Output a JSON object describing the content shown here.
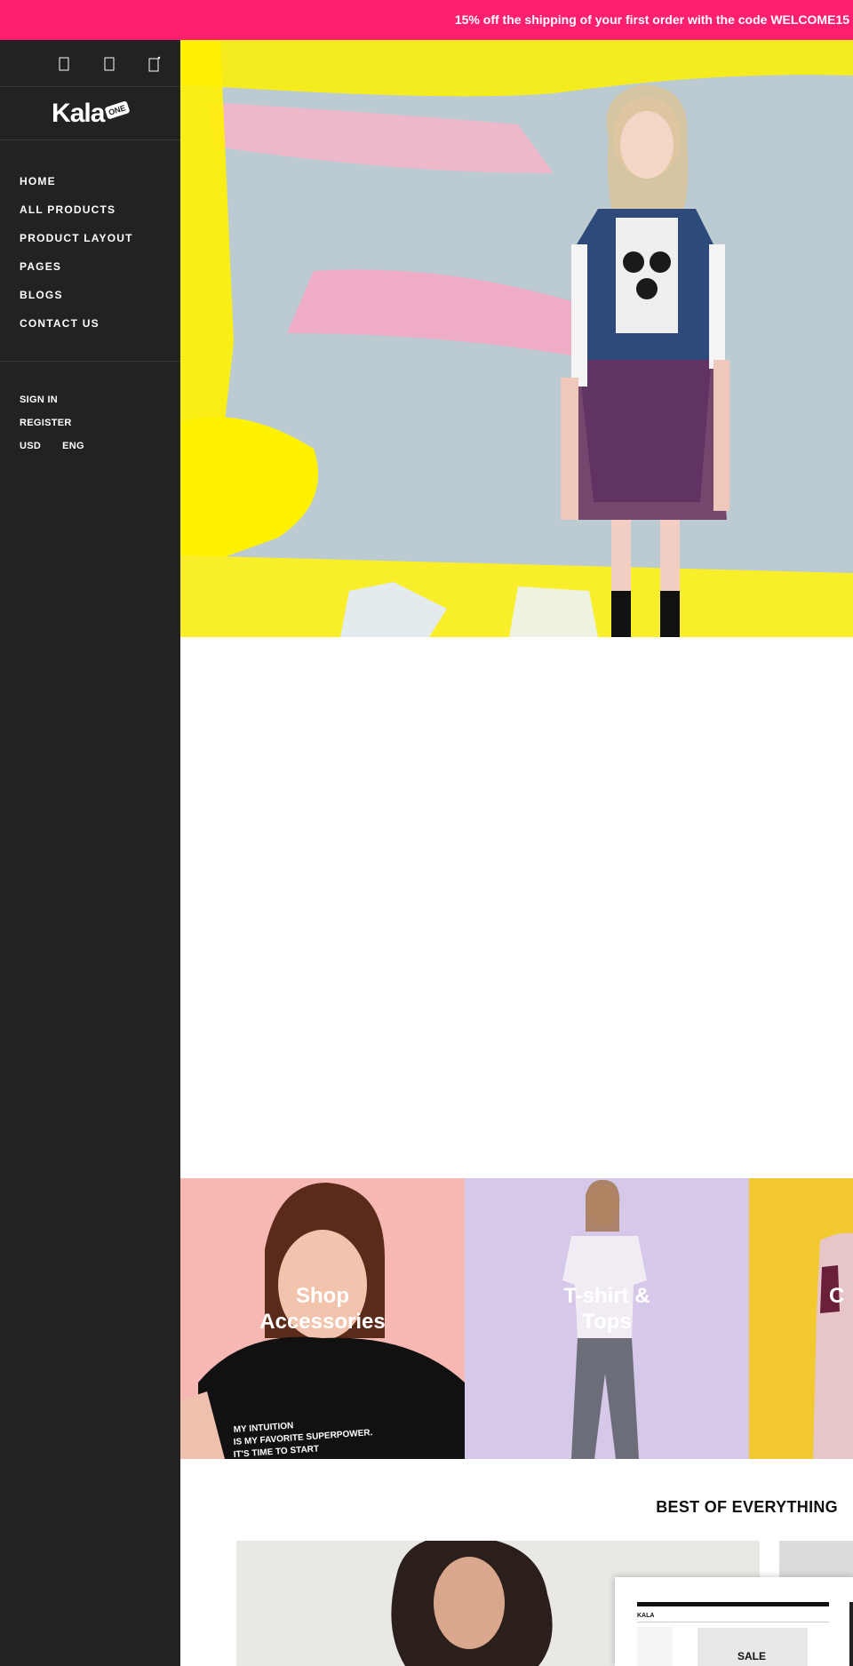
{
  "announcement": {
    "text": "15% off the shipping of your first order with the code WELCOME15"
  },
  "sidebar": {
    "icons": [
      "search-icon",
      "user-icon",
      "cart-icon"
    ],
    "logo": {
      "text": "Kala",
      "badge": "ONE"
    },
    "nav": [
      {
        "label": "HOME"
      },
      {
        "label": "ALL PRODUCTS"
      },
      {
        "label": "PRODUCT LAYOUT"
      },
      {
        "label": "PAGES"
      },
      {
        "label": "BLOGS"
      },
      {
        "label": "CONTACT US"
      }
    ],
    "account": {
      "sign_in": "SIGN IN",
      "register": "REGISTER",
      "currency": "USD",
      "language": "ENG"
    }
  },
  "collections": [
    {
      "title_line1": "Shop",
      "title_line2": "Accessories"
    },
    {
      "title_line1": "T-shirt &",
      "title_line2": "Tops"
    },
    {
      "title_line1": "C",
      "title_line2": ""
    }
  ],
  "shirt_print": [
    "MY INTUITION",
    "IS MY FAVORITE SUPERPOWER.",
    "IT'S TIME TO START"
  ],
  "best": {
    "title": "BEST OF EVERYTHING"
  },
  "preview": {
    "logo": "KALA",
    "sale": "SALE"
  },
  "colors": {
    "accent": "#ff1f6e",
    "sidebar_bg": "#222222"
  }
}
